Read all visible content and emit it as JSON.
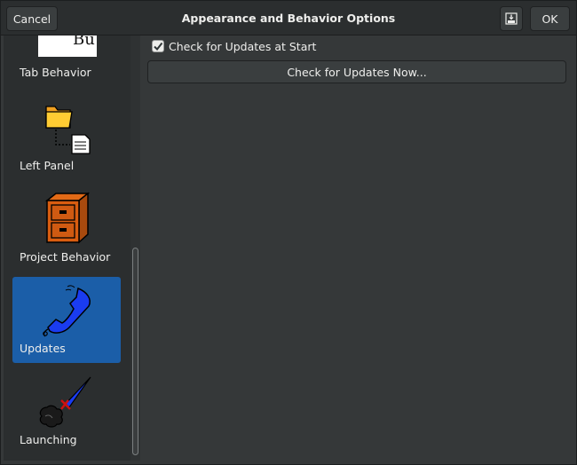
{
  "header": {
    "title": "Appearance and Behavior Options",
    "cancel_label": "Cancel",
    "ok_label": "OK",
    "save_icon": "save-download-icon"
  },
  "sidebar": {
    "partial_item_text": "Bu",
    "items": [
      {
        "label": "Tab Behavior",
        "icon": "tab-behavior-icon",
        "selected": false
      },
      {
        "label": "Left Panel",
        "icon": "folder-tree-icon",
        "selected": false
      },
      {
        "label": "Project Behavior",
        "icon": "filing-cabinet-icon",
        "selected": false
      },
      {
        "label": "Updates",
        "icon": "telephone-handset-icon",
        "selected": true
      },
      {
        "label": "Launching",
        "icon": "rocket-launch-icon",
        "selected": false
      }
    ]
  },
  "main": {
    "check_updates_at_start": {
      "label": "Check for Updates at Start",
      "checked": true
    },
    "check_now_label": "Check for Updates Now..."
  },
  "colors": {
    "selection": "#1b5ea8",
    "background": "#353839",
    "sidebar_bg": "#2b2e2f"
  }
}
